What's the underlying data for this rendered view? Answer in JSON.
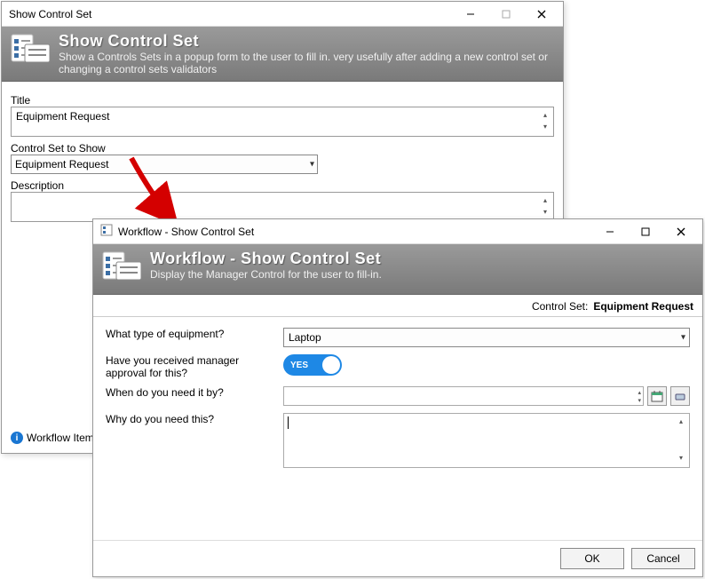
{
  "parent": {
    "titlebar": "Show Control Set",
    "banner_title": "Show Control Set",
    "banner_desc": "Show a Controls Sets in a popup form to the user to fill in.  very usefully after adding a new control set or changing a control sets validators",
    "fields": {
      "title_label": "Title",
      "title_value": "Equipment Request",
      "cs_label": "Control Set to Show",
      "cs_value": "Equipment Request",
      "desc_label": "Description"
    },
    "status_link": "Workflow Item"
  },
  "child": {
    "titlebar": "Workflow - Show Control Set",
    "banner_title": "Workflow - Show Control Set",
    "banner_desc": "Display the Manager Control for the user to fill-in.",
    "cs_header_label": "Control Set:",
    "cs_header_value": "Equipment Request",
    "rows": {
      "r1_label": "What type of equipment?",
      "r1_value": "Laptop",
      "r2_label": "Have you received manager approval for this?",
      "r2_toggle": "YES",
      "r3_label": "When do you need it by?",
      "r4_label": "Why do you need this?"
    },
    "buttons": {
      "ok": "OK",
      "cancel": "Cancel"
    }
  }
}
